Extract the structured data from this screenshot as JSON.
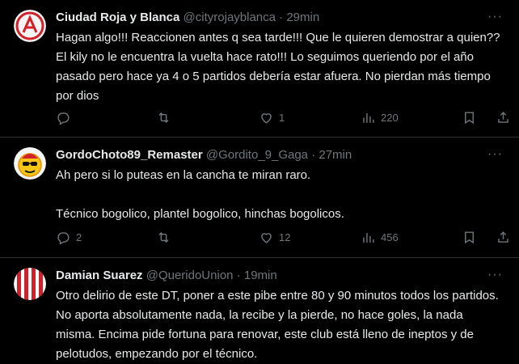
{
  "tweets": [
    {
      "name": "Ciudad Roja y Blanca",
      "handle": "@cityrojayblanca",
      "separator": "·",
      "time": "29min",
      "text": "Hagan algo!!! Reaccionen antes q sea tarde!!! Que le quieren demostrar a quien?? El kily no le encuentra la vuelta hace rato!!! Lo seguimos queriendo por el año pasado pero hace ya 4 o 5 partidos debería estar afuera. No pierdan más tiempo por dios",
      "replies": "",
      "retweets": "",
      "likes": "1",
      "views": "220"
    },
    {
      "name": "GordoChoto89_Remaster",
      "handle": "@Gordito_9_Gaga",
      "separator": "·",
      "time": "27min",
      "text": "Ah pero si lo puteas en la cancha te miran raro.\n\nTécnico bogolico, plantel bogolico, hinchas bogolicos.",
      "replies": "2",
      "retweets": "",
      "likes": "12",
      "views": "456"
    },
    {
      "name": "Damian Suarez",
      "handle": "@QueridoUnion",
      "separator": "·",
      "time": "19min",
      "text": "Otro delirio de este DT, poner a este pibe entre 80 y 90 minutos todos los partidos. No aporta absolutamente nada, la recibe y la pierde, no hace goles, la nada misma. Encima pide fortuna para renovar, este club está lleno de ineptos y de pelotudos, empezando por el técnico."
    }
  ],
  "icons": {
    "more": "more-icon",
    "reply": "reply-icon",
    "retweet": "retweet-icon",
    "like": "like-icon",
    "views": "views-icon",
    "bookmark": "bookmark-icon",
    "share": "share-icon"
  },
  "colors": {
    "background": "#000000",
    "text": "#e7e9ea",
    "muted": "#71767b",
    "divider": "#2f3336"
  }
}
